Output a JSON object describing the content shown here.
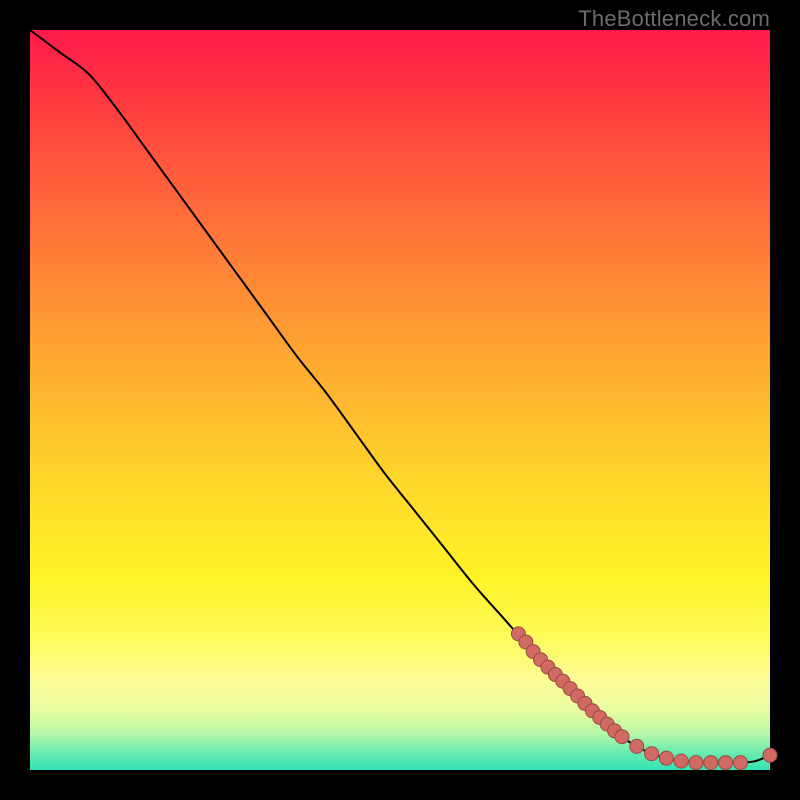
{
  "attribution": "TheBottleneck.com",
  "chart_data": {
    "type": "line",
    "title": "",
    "xlabel": "",
    "ylabel": "",
    "xlim": [
      0,
      100
    ],
    "ylim": [
      0,
      100
    ],
    "series": [
      {
        "name": "curve",
        "stroke": "#000000",
        "x": [
          0,
          4,
          8,
          12,
          16,
          20,
          24,
          28,
          32,
          36,
          40,
          44,
          48,
          52,
          56,
          60,
          64,
          68,
          72,
          76,
          80,
          82,
          84,
          86,
          88,
          90,
          92,
          94,
          96,
          98,
          100
        ],
        "y": [
          100,
          97,
          94,
          89,
          83.5,
          78,
          72.5,
          67,
          61.5,
          56,
          51,
          45.5,
          40,
          35,
          30,
          25,
          20.5,
          16,
          12,
          8,
          4.5,
          3.2,
          2.2,
          1.6,
          1.2,
          1.0,
          1.0,
          1.0,
          1.0,
          1.2,
          2.0
        ]
      }
    ],
    "markers": {
      "name": "highlighted-points",
      "fill": "#d16a62",
      "stroke": "#9a4a44",
      "radius_px": 7,
      "x": [
        66,
        67,
        68,
        69,
        70,
        71,
        72,
        73,
        74,
        75,
        76,
        77,
        78,
        79,
        80,
        82,
        84,
        86,
        88,
        90,
        92,
        94,
        96,
        100
      ],
      "y": [
        18.4,
        17.3,
        16,
        14.9,
        13.9,
        12.9,
        12,
        11,
        10,
        9,
        8,
        7.1,
        6.2,
        5.3,
        4.5,
        3.2,
        2.2,
        1.6,
        1.2,
        1.0,
        1.0,
        1.0,
        1.0,
        2.0
      ]
    }
  },
  "colors": {
    "page_bg": "#000000",
    "attribution_text": "#6c6c6c"
  }
}
